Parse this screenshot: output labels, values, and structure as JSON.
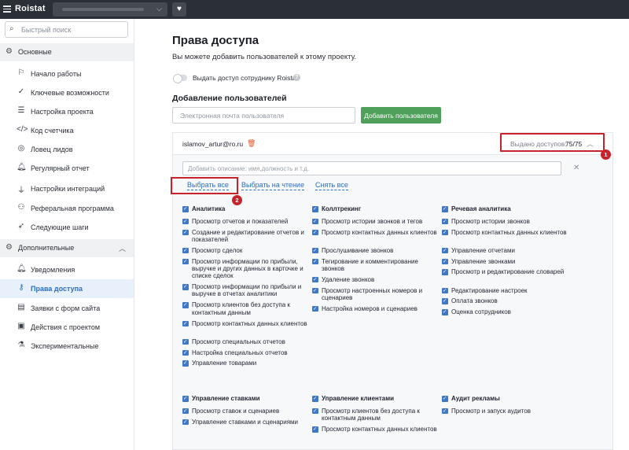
{
  "app": {
    "logo": "Roistat",
    "heart_glyph": "♥"
  },
  "sidebar": {
    "search_placeholder": "Быстрый поиск",
    "sections": [
      {
        "label": "Основные",
        "icon": "gear-icon",
        "items": [
          {
            "label": "Начало работы",
            "icon": "flag-icon"
          },
          {
            "label": "Ключевые возможности",
            "icon": "check-circle-icon"
          },
          {
            "label": "Настройка проекта",
            "icon": "settings-sliders-icon"
          },
          {
            "label": "Код счетчика",
            "icon": "code-icon"
          },
          {
            "label": "Ловец лидов",
            "icon": "target-icon"
          },
          {
            "label": "Регулярный отчет",
            "icon": "bell-icon"
          },
          {
            "label": "Настройки интеграций",
            "icon": "plug-icon"
          },
          {
            "label": "Реферальная программа",
            "icon": "users-icon"
          },
          {
            "label": "Следующие шаги",
            "icon": "rocket-icon"
          }
        ]
      },
      {
        "label": "Дополнительные",
        "icon": "gears-icon",
        "items": [
          {
            "label": "Уведомления",
            "icon": "bell-icon"
          },
          {
            "label": "Права доступа",
            "icon": "key-icon",
            "active": true
          },
          {
            "label": "Заявки с форм сайта",
            "icon": "form-icon"
          },
          {
            "label": "Действия с проектом",
            "icon": "clipboard-icon"
          },
          {
            "label": "Экспериментальные",
            "icon": "flask-icon"
          }
        ]
      }
    ]
  },
  "main": {
    "title": "Права доступа",
    "subtitle": "Вы можете добавить пользователей к этому проекту.",
    "toggle_label": "Выдать доступ сотруднику Roistat",
    "add_title": "Добавление пользователей",
    "email_placeholder": "Электронная почта пользователя",
    "add_button": "Добавить пользователя",
    "user": {
      "email": "islamov_artur@ro.ru",
      "access_label": "Выдано доступов:",
      "access_value": "75/75",
      "description_placeholder": "Добавить описание: имя,должность и т.д.",
      "links": {
        "select_all": "Выбрать все",
        "select_read": "Выбрать на чтение",
        "clear_all": "Снять все"
      },
      "markers": [
        "1",
        "2"
      ],
      "permissions": [
        {
          "col": 0,
          "row": 0,
          "items": [
            {
              "label": "Аналитика",
              "head": true,
              "lines": 1
            },
            {
              "label": "Просмотр отчетов и показателей",
              "lines": 1
            },
            {
              "label": "Создание и редактирование отчетов и показателей",
              "lines": 2
            },
            {
              "label": "Просмотр сделок",
              "lines": 1
            },
            {
              "label": "Просмотр информации по прибыли, выручке и других данных в карточке и списке сделок",
              "lines": 3
            },
            {
              "label": "Просмотр информации по прибыли и выручке в отчетах аналитики",
              "lines": 2
            },
            {
              "label": "Просмотр клиентов без доступа к контактным данным",
              "lines": 2
            },
            {
              "label": "Просмотр контактных данных клиентов",
              "lines": 2
            },
            {
              "label": "Просмотр специальных отчетов",
              "lines": 1
            },
            {
              "label": "Настройка специальных отчетов",
              "lines": 1
            },
            {
              "label": "Управление товарами",
              "lines": 1
            }
          ]
        },
        {
          "col": 1,
          "row": 0,
          "items": [
            {
              "label": "Коллтрекинг",
              "head": true,
              "lines": 1
            },
            {
              "label": "Просмотр истории звонков и тегов",
              "lines": 1
            },
            {
              "label": "Просмотр контактных данных клиентов",
              "lines": 2
            },
            {
              "label": "Прослушивание звонков",
              "lines": 1
            },
            {
              "label": "Тегирование и комментирование звонков",
              "lines": 2
            },
            {
              "label": "Удаление звонков",
              "lines": 1
            },
            {
              "label": "Просмотр настроенных номеров и сценариев",
              "lines": 2
            },
            {
              "label": "Настройка номеров и сценариев",
              "lines": 1
            }
          ]
        },
        {
          "col": 2,
          "row": 0,
          "items": [
            {
              "label": "Речевая аналитика",
              "head": true,
              "lines": 1
            },
            {
              "label": "Просмотр истории звонков",
              "lines": 1
            },
            {
              "label": "Просмотр контактных данных клиентов",
              "lines": 2
            },
            {
              "label": "Управление отчетами",
              "lines": 1
            },
            {
              "label": "Управление звонками",
              "lines": 1
            },
            {
              "label": "Просмотр и редактирование словарей",
              "lines": 2
            },
            {
              "label": "Редактирование настроек",
              "lines": 1
            },
            {
              "label": "Оплата звонков",
              "lines": 1
            },
            {
              "label": "Оценка сотрудников",
              "lines": 1
            }
          ]
        },
        {
          "col": 0,
          "row": 1,
          "items": [
            {
              "label": "Управление ставками",
              "head": true,
              "lines": 1
            },
            {
              "label": "Просмотр ставок и сценариев",
              "lines": 1
            },
            {
              "label": "Управление ставками и сценариями",
              "lines": 1
            }
          ]
        },
        {
          "col": 1,
          "row": 1,
          "items": [
            {
              "label": "Управление клиентами",
              "head": true,
              "lines": 1
            },
            {
              "label": "Просмотр клиентов без доступа к контактным данным",
              "lines": 2
            },
            {
              "label": "Просмотр контактных данных клиентов",
              "lines": 2
            }
          ]
        },
        {
          "col": 2,
          "row": 1,
          "items": [
            {
              "label": "Аудит рекламы",
              "head": true,
              "lines": 1
            },
            {
              "label": "Просмотр и запуск аудитов",
              "lines": 1
            }
          ]
        }
      ]
    }
  },
  "colors": {
    "accent": "#2a6fc4",
    "green": "#4fa05a",
    "highlight_red": "#c8222a",
    "topbar": "#2b2f36"
  }
}
